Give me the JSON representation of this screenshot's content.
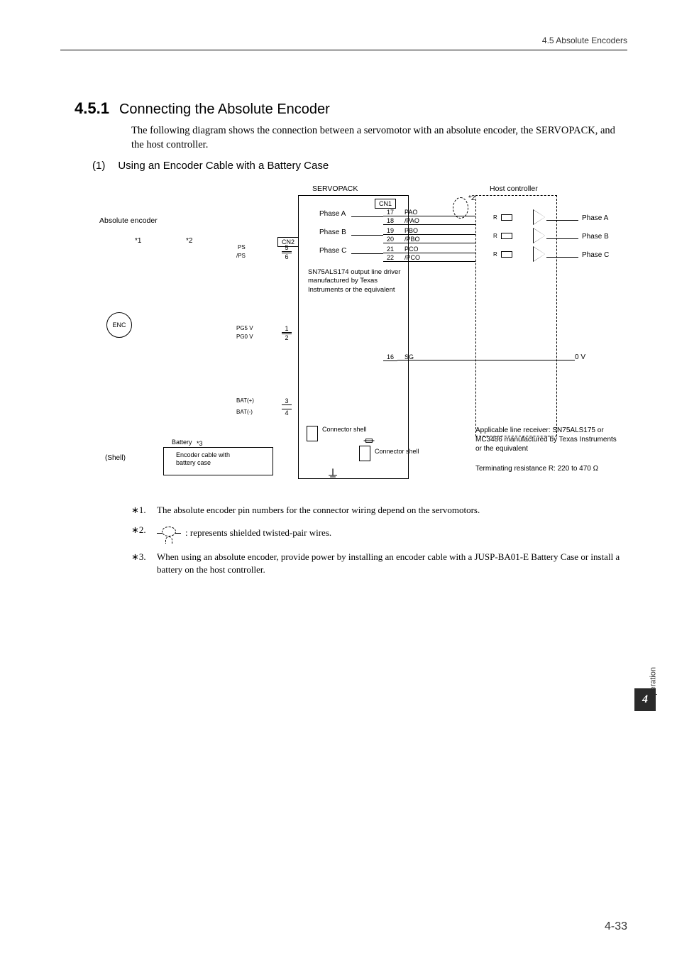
{
  "header": {
    "breadcrumb": "4.5  Absolute Encoders"
  },
  "section": {
    "number": "4.5.1",
    "title": "Connecting the Absolute Encoder",
    "intro": "The following diagram shows the connection between a servomotor with an absolute encoder, the SERVOPACK, and the host controller."
  },
  "subsection": {
    "number": "(1)",
    "title": "Using an Encoder Cable with a Battery Case"
  },
  "diagram": {
    "servopack": "SERVOPACK",
    "host": "Host controller",
    "abs_encoder": "Absolute encoder",
    "enc": "ENC",
    "shell": "(Shell)",
    "cn1": "CN1",
    "cn2": "CN2",
    "phaseA": "Phase A",
    "phaseB": "Phase B",
    "phaseC": "Phase C",
    "star1": "*1",
    "star2": "*2",
    "star3": "*3",
    "ps": "PS",
    "psn": "/PS",
    "pg5v": "PG5 V",
    "pg0v": "PG0 V",
    "batp": "BAT(+)",
    "batn": "BAT(-)",
    "pin1": "1",
    "pin2": "2",
    "pin3": "3",
    "pin4": "4",
    "pin5": "5",
    "pin6": "6",
    "pin16": "16",
    "pin17": "17",
    "pin18": "18",
    "pin19": "19",
    "pin20": "20",
    "pin21": "21",
    "pin22": "22",
    "pao": "PAO",
    "paon": "/PAO",
    "pbo": "PBO",
    "pbon": "/PBO",
    "pco": "PCO",
    "pcon": "/PCO",
    "sg": "SG",
    "zeroV": "0 V",
    "r": "R",
    "sn74": "SN75ALS174 output line driver manufactured by Texas Instruments or the equivalent",
    "battery": "Battery",
    "enc_cable": "Encoder cable with battery case",
    "conn_shell": "Connector shell",
    "applicable": "Applicable line receiver: SN75ALS175 or MC3486 manufactured by Texas Instruments or the equivalent",
    "term": "Terminating resistance R: 220 to 470 Ω"
  },
  "footnotes": {
    "n1_num": "∗1.",
    "n1_text": "The absolute encoder pin numbers for the connector wiring depend on the servomotors.",
    "n2_num": "∗2.",
    "n2_text": ": represents shielded twisted-pair wires.",
    "n3_num": "∗3.",
    "n3_text": "When using an absolute encoder, provide power by installing an encoder cable with a JUSP-BA01-E Battery Case or install a battery on the host controller."
  },
  "sidetab": {
    "label": "Operation",
    "number": "4"
  },
  "page": {
    "number": "4-33"
  }
}
